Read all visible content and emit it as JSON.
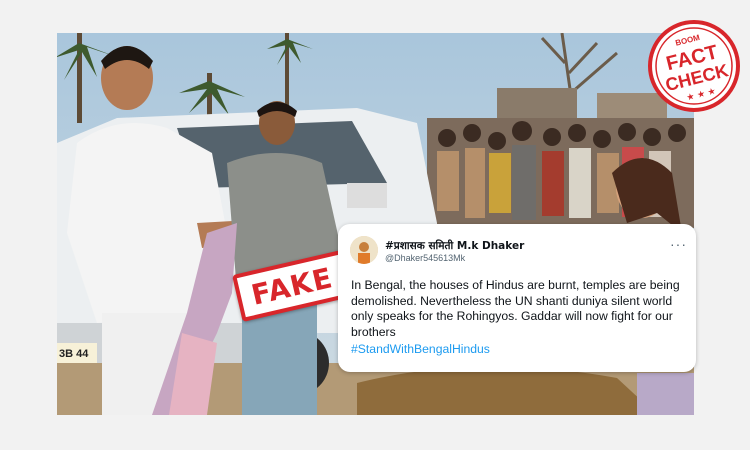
{
  "stamp": {
    "fake_label": "FAKE"
  },
  "badge": {
    "brand": "BOOM",
    "line1": "FACT",
    "line2": "CHECK",
    "stars": "★ ★ ★"
  },
  "tweet": {
    "display_name": "#प्रशासक समिती M.k Dhaker",
    "handle": "@Dhaker545613Mk",
    "text": "In Bengal, the houses of Hindus are burnt, temples are being demolished. Nevertheless the UN shanti duniya silent world only speaks for the Rohingyos. Gaddar will now fight for our brothers",
    "hashtag": "#StandWithBengalHindus",
    "more_icon": "···"
  },
  "photo": {
    "plate_text": "3B 44"
  },
  "colors": {
    "accent_red": "#d8262b",
    "link_blue": "#1d9bf0"
  }
}
